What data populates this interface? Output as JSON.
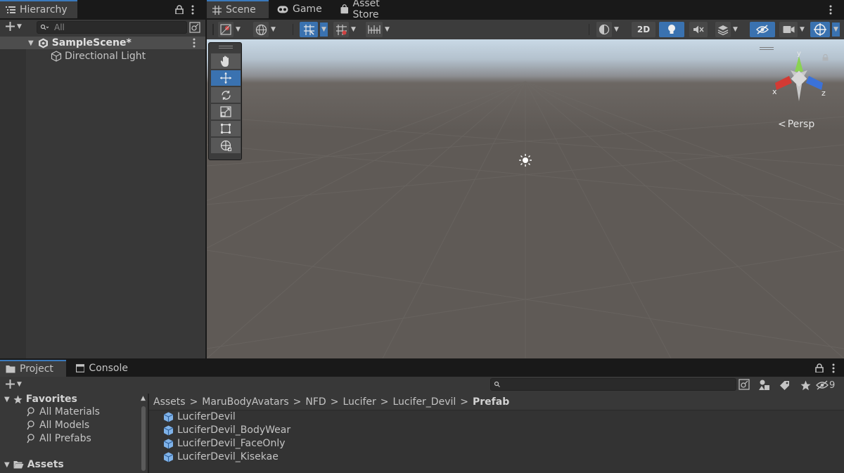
{
  "hierarchy": {
    "tab_label": "Hierarchy",
    "search_placeholder": "All",
    "scene_name": "SampleScene*",
    "items": [
      {
        "label": "Directional Light"
      }
    ]
  },
  "scene_tabs": {
    "scene": "Scene",
    "game": "Game",
    "asset_store": "Asset Store"
  },
  "scene_toolbar": {
    "two_d_label": "2D"
  },
  "scene_view": {
    "projection_label": "Persp",
    "gizmo_axes": {
      "x": "x",
      "y": "y",
      "z": "z"
    },
    "colors": {
      "sky_top": "#c9d9e6",
      "horizon": "#8d8f93",
      "ground": "#5f5a56",
      "selected_tool": "#3a72b0"
    }
  },
  "tools": [
    "hand-tool",
    "move-tool",
    "rotate-tool",
    "scale-tool",
    "rect-tool",
    "transform-tool"
  ],
  "bottom_tabs": {
    "project": "Project",
    "console": "Console"
  },
  "project": {
    "favorites_label": "Favorites",
    "favorites": [
      "All Materials",
      "All Models",
      "All Prefabs"
    ],
    "assets_label": "Assets",
    "hidden_count": "9",
    "breadcrumb": [
      "Assets",
      "MaruBodyAvatars",
      "NFD",
      "Lucifer",
      "Lucifer_Devil",
      "Prefab"
    ],
    "files": [
      "LuciferDevil",
      "LuciferDevil_BodyWear",
      "LuciferDevil_FaceOnly",
      "LuciferDevil_Kisekae"
    ]
  }
}
